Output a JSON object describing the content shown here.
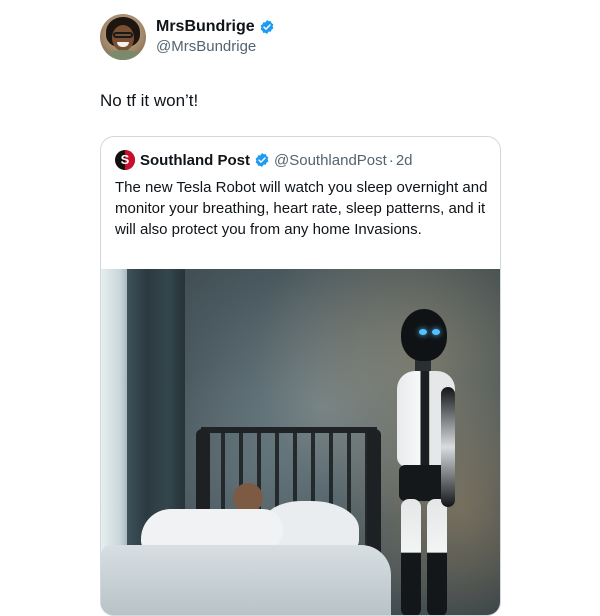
{
  "author": {
    "display_name": "MrsBundrige",
    "handle": "@MrsBundrige",
    "verified": true
  },
  "tweet": {
    "text": "No tf it won’t!"
  },
  "quote": {
    "display_name": "Southland Post",
    "handle": "@SouthlandPost",
    "separator": "·",
    "time": "2d",
    "verified": true,
    "logo_letter": "S",
    "text": "The new Tesla Robot will watch you sleep overnight and monitor your breathing, heart rate, sleep patterns, and it will also protect you from any home Invasions."
  },
  "colors": {
    "verified_blue": "#1d9bf0",
    "secondary_text": "#536471",
    "border": "#cfd9de"
  },
  "icons": {
    "verified": "verified-badge-icon",
    "quote_logo": "southland-post-logo"
  }
}
